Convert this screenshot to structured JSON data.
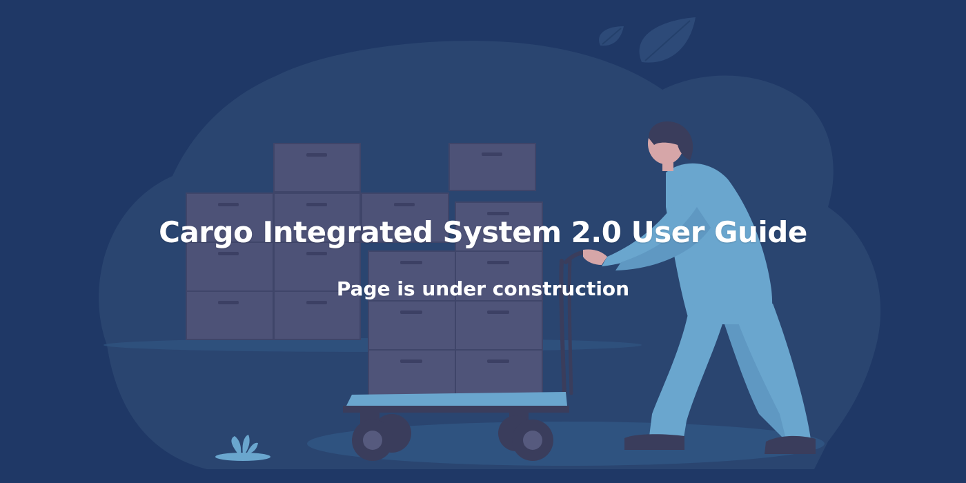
{
  "page": {
    "title": "Cargo Integrated System 2.0 User Guide",
    "subtitle": "Page is under construction"
  },
  "colors": {
    "background": "#1f3866",
    "cloud": "#2a4570",
    "box": "#4d5277",
    "box_dark": "#42476b",
    "worker_suit": "#6aa6ce",
    "skin": "#d6a6a8",
    "hair": "#3a3d5c",
    "text": "#ffffff"
  },
  "illustration": {
    "name": "worker pushing cargo cart",
    "icons": [
      "leaf-icon",
      "plant-icon"
    ]
  }
}
